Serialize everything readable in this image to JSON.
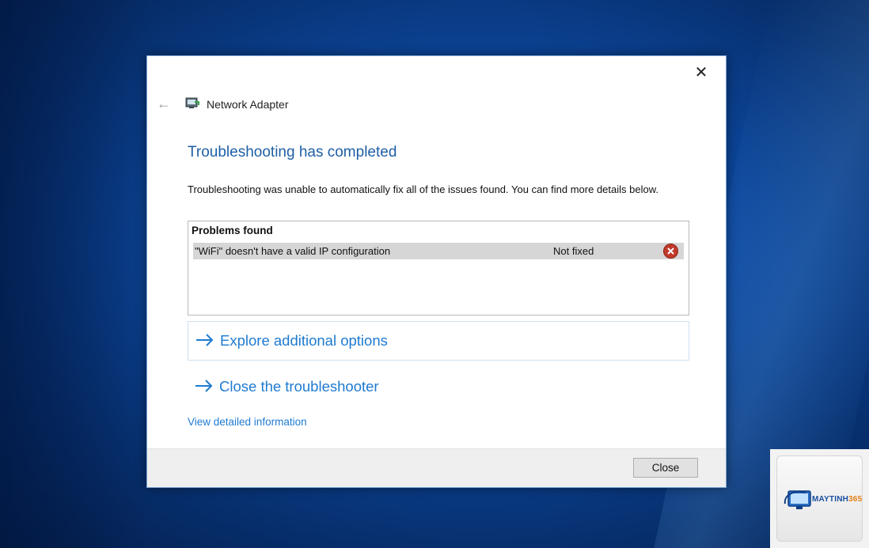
{
  "window": {
    "app_title": "Network Adapter",
    "icons": {
      "back": "back-arrow-icon",
      "app": "network-adapter-icon",
      "close": "close-icon"
    }
  },
  "content": {
    "heading": "Troubleshooting has completed",
    "message": "Troubleshooting was unable to automatically fix all of the issues found. You can find more details below.",
    "problems": {
      "header": "Problems found",
      "rows": [
        {
          "description": "\"WiFi\" doesn't have a valid IP configuration",
          "status": "Not fixed",
          "status_icon": "error-icon"
        }
      ]
    },
    "options": [
      {
        "label": "Explore additional options",
        "icon": "arrow-right-icon"
      },
      {
        "label": "Close the troubleshooter",
        "icon": "arrow-right-icon"
      }
    ],
    "details_link": "View detailed information"
  },
  "footer": {
    "close_label": "Close"
  },
  "watermark": {
    "brand_main": "MAYTINH",
    "brand_accent": "365"
  },
  "colors": {
    "heading": "#1e5fa6",
    "link": "#1e7ad0",
    "error": "#c0392b",
    "desktop": "#0d4aa3"
  }
}
